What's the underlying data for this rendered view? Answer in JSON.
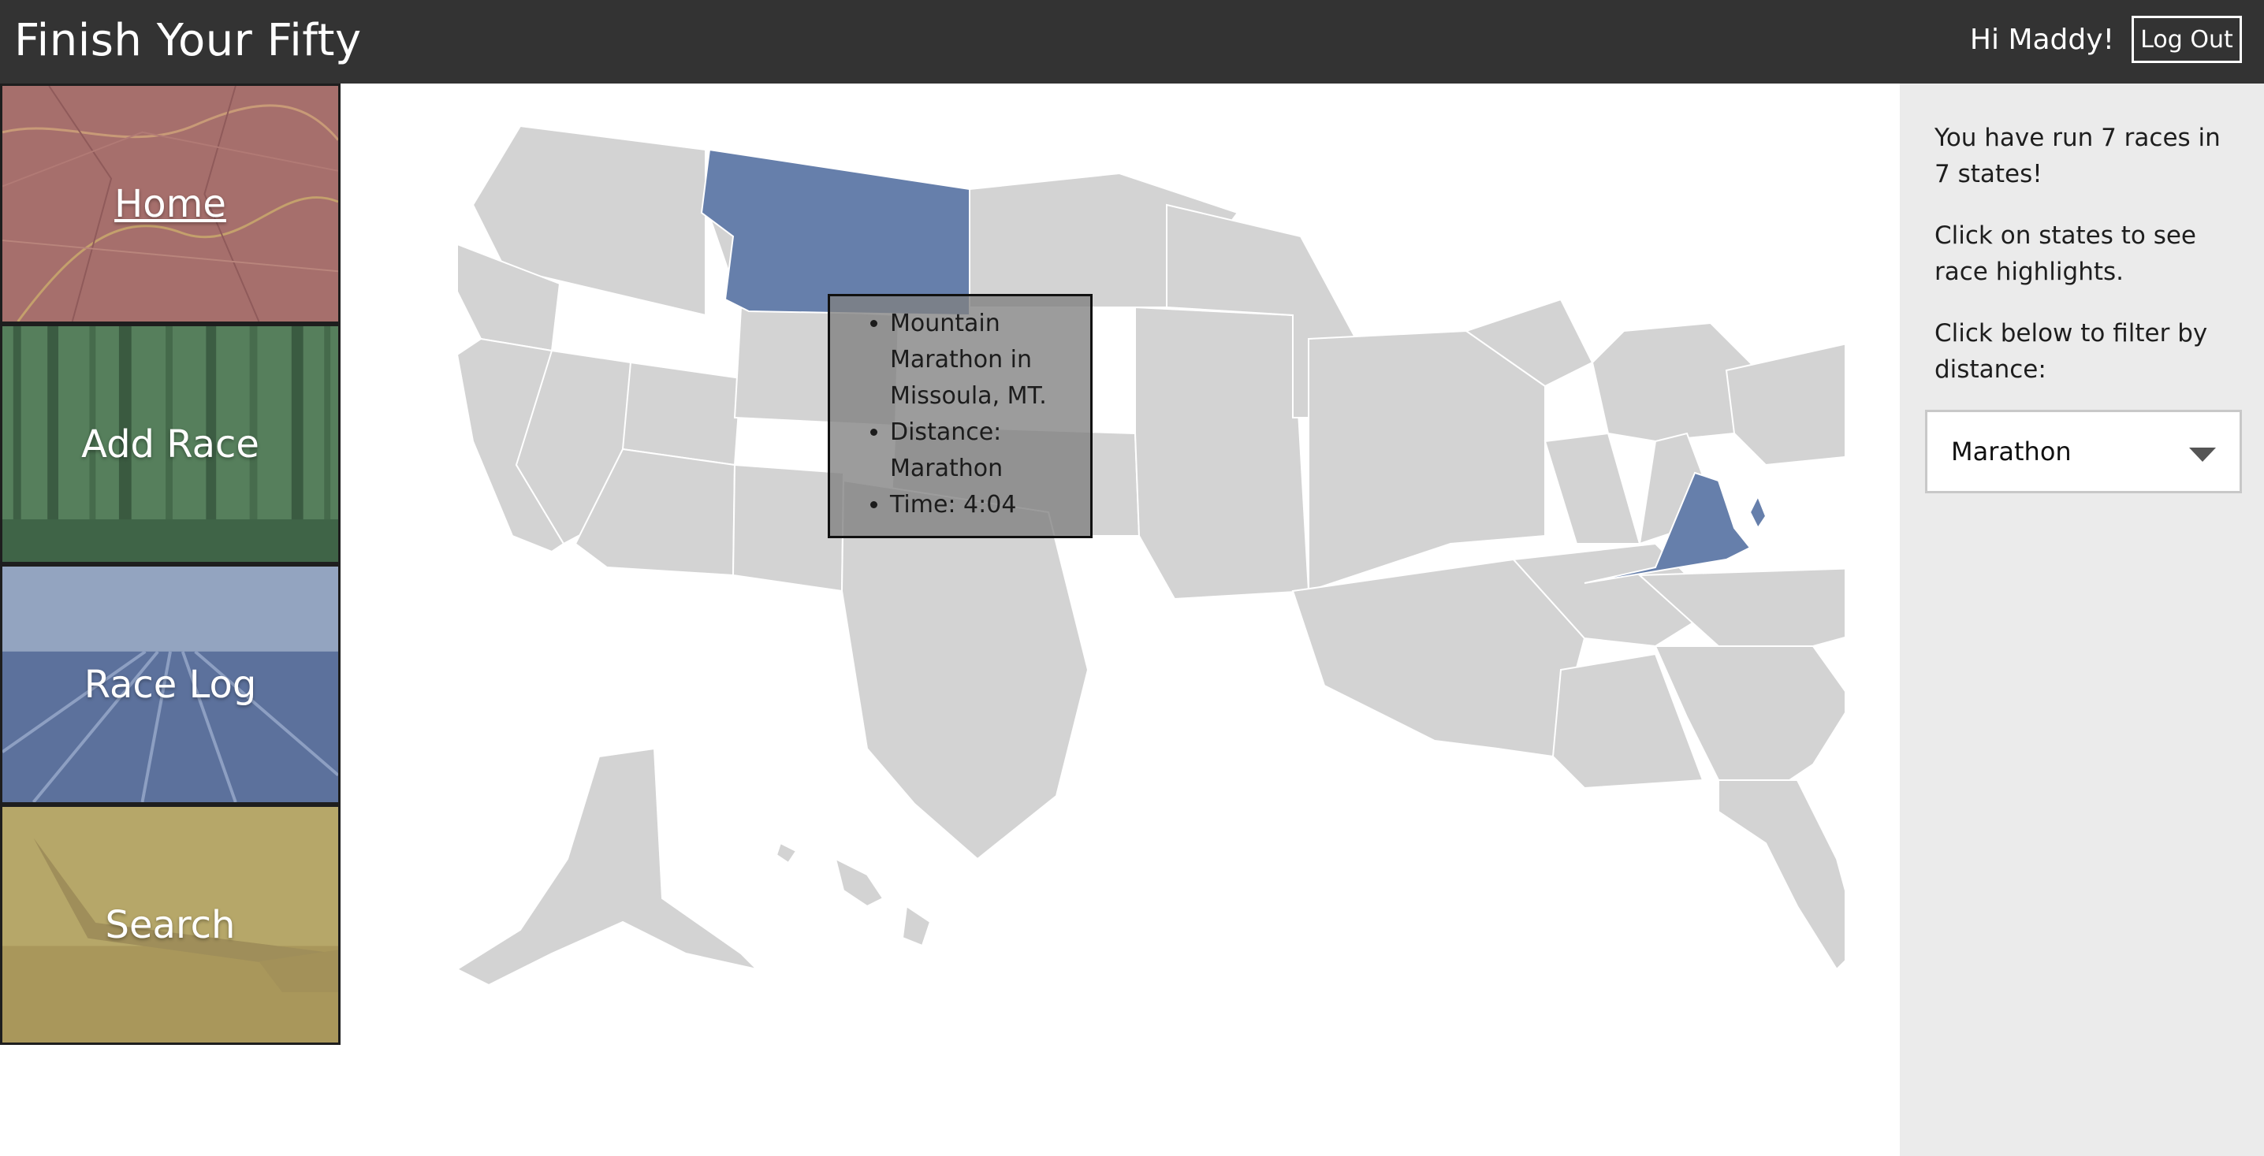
{
  "app": {
    "title": "Finish Your Fifty"
  },
  "header": {
    "greeting": "Hi Maddy!",
    "logout_label": "Log Out"
  },
  "nav": {
    "items": [
      {
        "label": "Home",
        "active": true
      },
      {
        "label": "Add Race"
      },
      {
        "label": "Race Log"
      },
      {
        "label": "Search"
      }
    ]
  },
  "map": {
    "highlight_color": "#667fab",
    "base_color": "#d3d3d3",
    "highlighted_states": [
      "MT",
      "VA",
      "DE"
    ]
  },
  "tooltip": {
    "race_line": "Mountain Marathon in Missoula, MT.",
    "distance_line": "Distance: Marathon",
    "time_line": "Time: 4:04"
  },
  "sidebar": {
    "summary": "You have run 7 races in 7 states!",
    "hint": "Click on states to see race highlights.",
    "filter_prompt": "Click below to filter by distance:",
    "filter": {
      "selected": "Marathon"
    }
  }
}
